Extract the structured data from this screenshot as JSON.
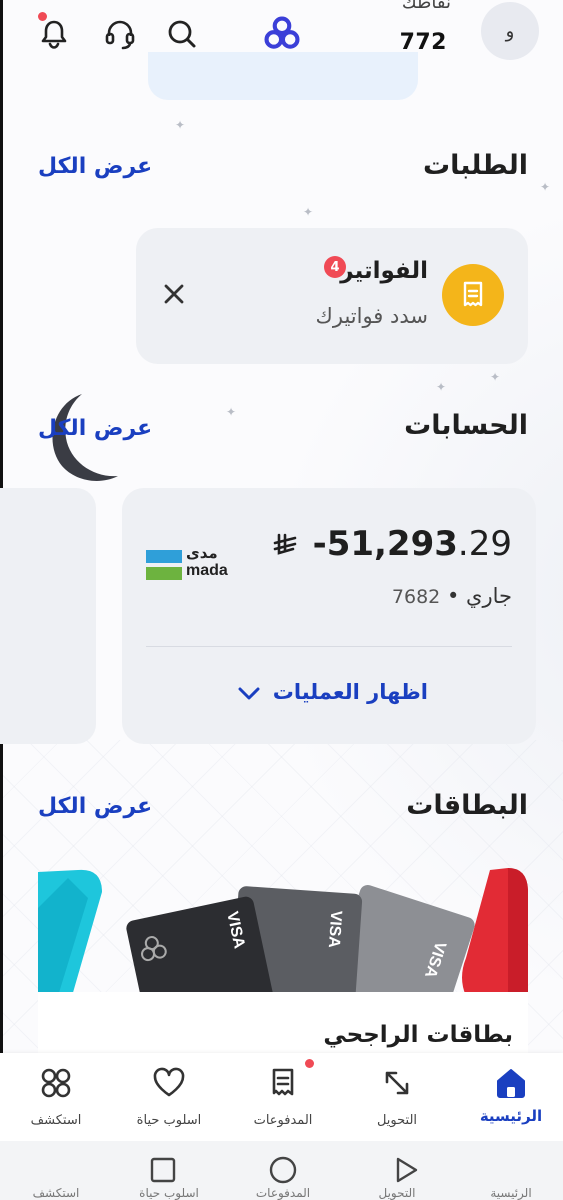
{
  "header": {
    "avatar_initial": "و",
    "points_label": "نقاطك",
    "points_value": "772",
    "icons": [
      "bell-icon",
      "headset-icon",
      "search-icon",
      "bank-logo-icon"
    ]
  },
  "requests": {
    "title": "الطلبات",
    "view_all": "عرض الكل",
    "card_title": "الفواتير",
    "card_subtitle": "سدد فواتيرك",
    "badge": "4"
  },
  "accounts": {
    "title": "الحسابات",
    "view_all": "عرض الكل",
    "amount_main": "-51,293",
    "amount_decimal": ".29",
    "currency_symbol": "⃁",
    "account_type": "جاري",
    "account_number": "7682",
    "network_label_ar": "مدى",
    "network_label_en": "mada",
    "show_transactions": "اظهار العمليات"
  },
  "cards": {
    "title": "البطاقات",
    "view_all": "عرض الكل",
    "card_name": "بطاقات الراجحي",
    "card_brand": "VISA"
  },
  "bottom_nav": [
    {
      "label": "الرئيسية",
      "icon": "home-icon",
      "active": true
    },
    {
      "label": "التحويل",
      "icon": "transfer-icon",
      "active": false
    },
    {
      "label": "المدفوعات",
      "icon": "payments-icon",
      "active": false
    },
    {
      "label": "اسلوب حياة",
      "icon": "heart-icon",
      "active": false
    },
    {
      "label": "استكشف",
      "icon": "explore-icon",
      "active": false
    }
  ],
  "colors": {
    "accent": "#1a3fc0",
    "badge": "#f04a55",
    "bill_icon_bg": "#f4b51a",
    "card_bg": "#eef0f4"
  }
}
